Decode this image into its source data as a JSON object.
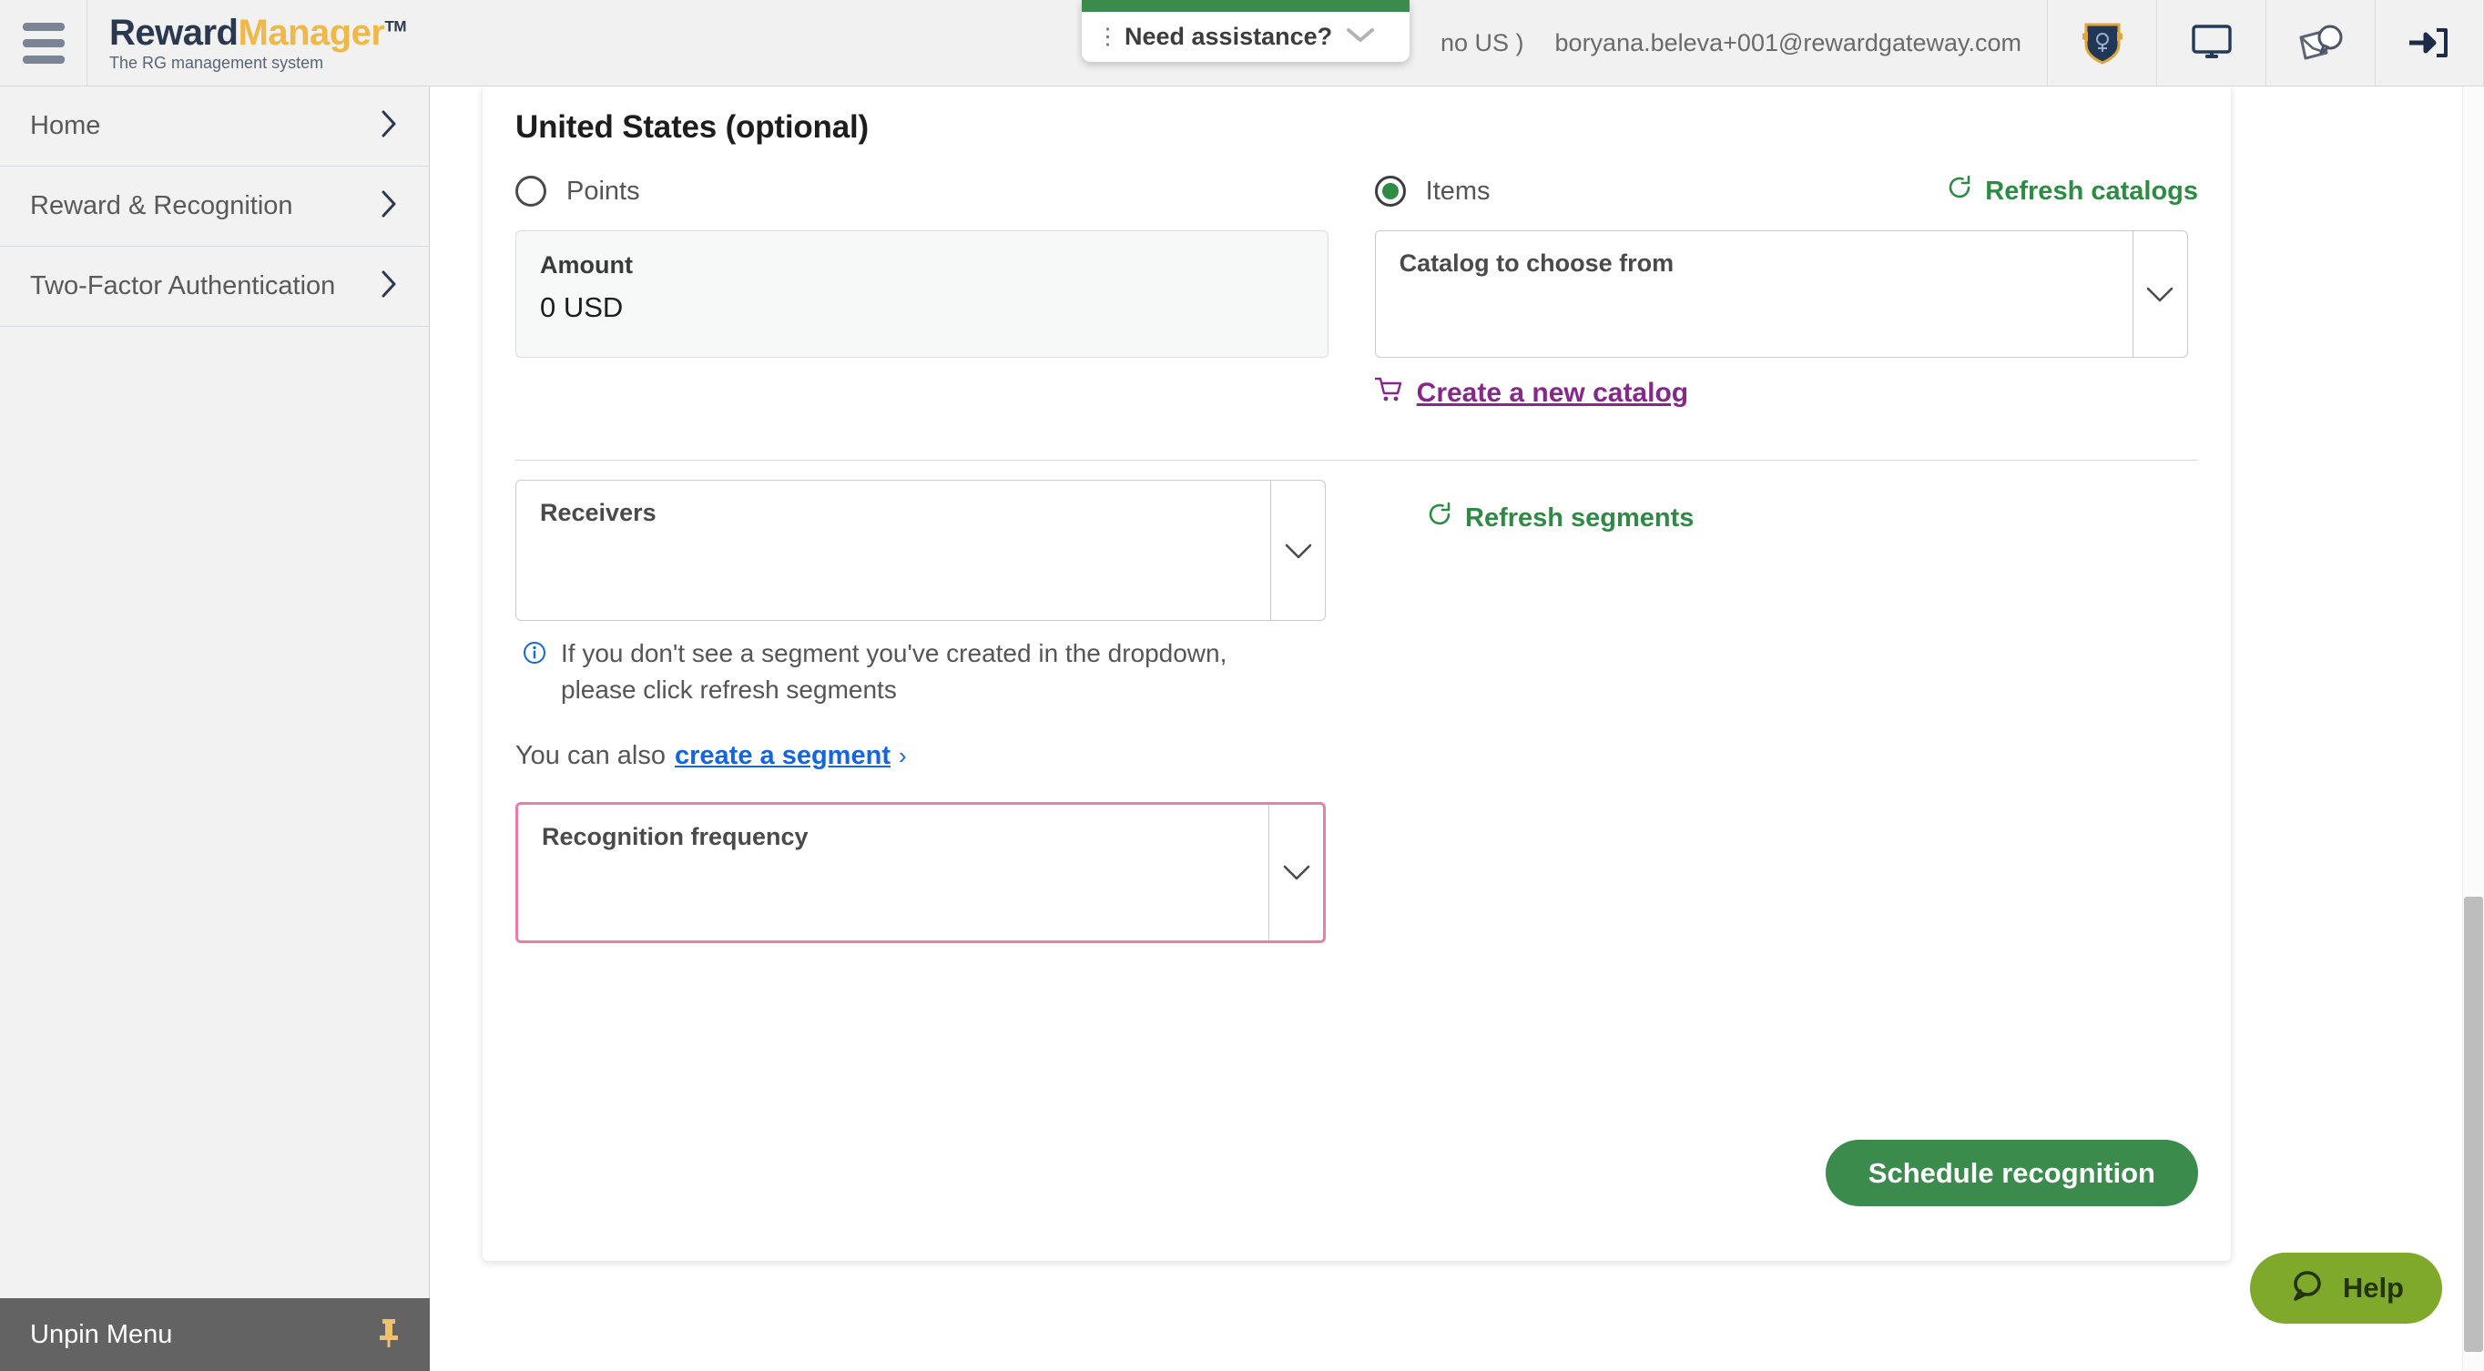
{
  "header": {
    "menu_icon": "hamburger-icon",
    "brand_part1": "Reward",
    "brand_part2": "Manager",
    "brand_tm": "TM",
    "brand_subtitle": "The RG management system",
    "account_context": "no US )",
    "account_email": "boryana.beleva+001@rewardgateway.com",
    "icons": [
      {
        "name": "shield-badge-icon",
        "label": "Rewards badge"
      },
      {
        "name": "monitor-icon",
        "label": "Display"
      },
      {
        "name": "envelope-chat-icon",
        "label": "Messages"
      },
      {
        "name": "logout-icon",
        "label": "Sign out"
      }
    ]
  },
  "assistance_popup": {
    "menu_dots": "⋮",
    "title": "Need assistance?",
    "caret_icon": "chevron-down-icon",
    "accent_color": "#3b8b4d"
  },
  "sidebar": {
    "items": [
      {
        "label": "Home"
      },
      {
        "label": "Reward & Recognition"
      },
      {
        "label": "Two-Factor Authentication"
      }
    ],
    "footer": {
      "label": "Unpin Menu",
      "icon": "pushpin-icon"
    }
  },
  "main": {
    "section_title": "United States (optional)",
    "points_option": {
      "label": "Points",
      "selected": false
    },
    "items_option": {
      "label": "Items",
      "selected": true
    },
    "refresh_catalogs": {
      "label": "Refresh catalogs",
      "icon": "refresh-icon"
    },
    "amount": {
      "label": "Amount",
      "value": "0 USD"
    },
    "catalog_select": {
      "label": "Catalog to choose from",
      "value": "",
      "arrow_icon": "chevron-down-icon"
    },
    "create_catalog": {
      "label": "Create a new catalog",
      "icon": "shopping-cart-icon"
    },
    "receivers_select": {
      "label": "Receivers",
      "value": "",
      "arrow_icon": "chevron-down-icon"
    },
    "refresh_segments": {
      "label": "Refresh segments",
      "icon": "refresh-icon"
    },
    "info_note": {
      "icon": "info-icon",
      "line1": "If you don't see a segment you've created in the dropdown,",
      "line2": "please click refresh segments"
    },
    "create_segment": {
      "prefix": "You can also",
      "link": "create a segment",
      "chevron": "›"
    },
    "frequency_select": {
      "label": "Recognition frequency",
      "value": "",
      "arrow_icon": "chevron-down-icon",
      "invalid": true,
      "error_color": "#e87fa8"
    },
    "schedule_button": {
      "label": "Schedule recognition",
      "color": "#3b8b4d"
    }
  },
  "help_widget": {
    "label": "Help",
    "icon": "chat-bubble-icon",
    "color": "#7fa92b"
  },
  "colors": {
    "green_accent": "#2e8b44",
    "purple_link": "#86288a",
    "blue_link": "#1565e0",
    "brand_navy": "#2a3850",
    "brand_gold": "#f0b849"
  }
}
